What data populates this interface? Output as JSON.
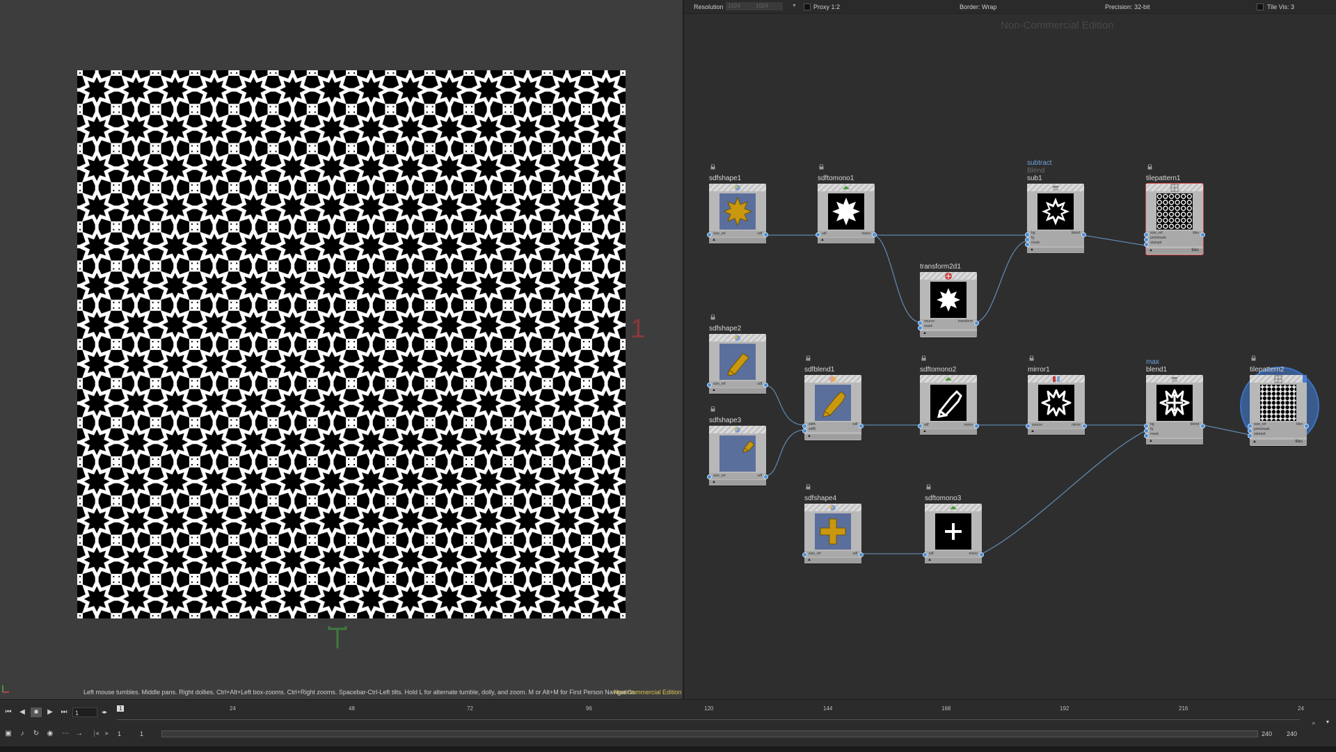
{
  "viewer": {
    "frame_label": "1",
    "hint": "Left mouse tumbles. Middle pans. Right dollies. Ctrl+Alt+Left box-zooms. Ctrl+Right zooms. Spacebar-Ctrl-Left tilts. Hold L for alternate tumble, dolly, and zoom. M or Alt+M for First Person Navigation.",
    "watermark": "Non-Commercial Edition",
    "pattern_foreground": "#ffffff",
    "pattern_background": "#000000"
  },
  "network": {
    "toolbar": {
      "resolution_label": "Resolution",
      "res_x": "1024",
      "res_y": "1024",
      "proxy_label": "Proxy 1:2",
      "border_label": "Border: Wrap",
      "precision_label": "Precision: 32-bit",
      "tilevis_label": "Tile Vis: 3"
    },
    "watermark": "Non-Commercial Edition",
    "wire_color": "#5f86ad",
    "nodes": {
      "sdfshape1": {
        "name": "sdfshape1",
        "in_port": "size_ref",
        "out_port": "sdf",
        "icon": "shape-icon"
      },
      "sdftomono1": {
        "name": "sdftomono1",
        "in_port": "sdf",
        "out_port": "mono",
        "icon": "convert-icon"
      },
      "sub1": {
        "name": "sub1",
        "op": "subtract",
        "mode": "Blend",
        "in_ports": [
          "bg",
          "fg",
          "mask"
        ],
        "out_port": "blend"
      },
      "tilepattern1": {
        "name": "tilepattern1",
        "in_ports": [
          "size_ref",
          "pointmask",
          "stampd"
        ],
        "out_port": "tiles",
        "footer": "tiles"
      },
      "transform2d1": {
        "name": "transform2d1",
        "in_ports": [
          "source",
          "mask"
        ],
        "out_port": "transform"
      },
      "sdfshape2": {
        "name": "sdfshape2",
        "in_port": "size_ref",
        "out_port": "sdf"
      },
      "sdfshape3": {
        "name": "sdfshape3",
        "in_port": "size_ref",
        "out_port": "sdf"
      },
      "sdfblend1": {
        "name": "sdfblend1",
        "in_ports": [
          "sdfA",
          "sdfB"
        ],
        "out_port": "sdf"
      },
      "sdftomono2": {
        "name": "sdftomono2",
        "in_port": "sdf",
        "out_port": "mono"
      },
      "mirror1": {
        "name": "mirror1",
        "in_port": "source",
        "out_port": "mirror"
      },
      "blend1": {
        "name": "blend1",
        "op": "max",
        "in_ports": [
          "bg",
          "fg",
          "mask"
        ],
        "out_port": "blend"
      },
      "tilepattern2": {
        "name": "tilepattern2",
        "in_ports": [
          "size_ref",
          "pointmask",
          "stampd"
        ],
        "out_port": "tiles",
        "footer": "tiles"
      },
      "sdfshape4": {
        "name": "sdfshape4",
        "in_port": "size_ref",
        "out_port": "sdf"
      },
      "sdftomono3": {
        "name": "sdftomono3",
        "in_port": "sdf",
        "out_port": "mono"
      }
    },
    "colors": {
      "shape_gold": "#c9980e",
      "shape_bg_blue": "#5b6f9c",
      "op_label_blue": "#6ea3e0",
      "mode_label_gray": "#6c6c6c",
      "selection_blue": "#4a7fd0"
    }
  },
  "timeline": {
    "current_frame": "1",
    "frame_box": "1",
    "tick_labels": [
      "1",
      "24",
      "48",
      "72",
      "96",
      "120",
      "144",
      "168",
      "192",
      "216",
      "24"
    ],
    "range_start": "1",
    "range_start2": "1",
    "range_end": "240",
    "range_end2": "240",
    "controls": [
      "jump-start",
      "step-back",
      "stop",
      "play",
      "jump-end"
    ]
  }
}
